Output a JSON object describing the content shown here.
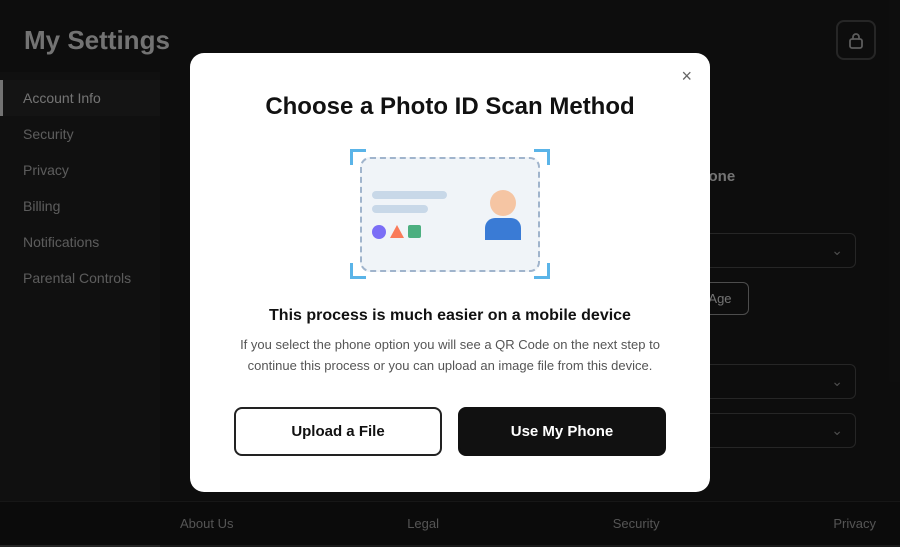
{
  "page": {
    "title": "My Settings",
    "lock_icon": "🔒"
  },
  "sidebar": {
    "items": [
      {
        "id": "account-info",
        "label": "Account Info",
        "active": true
      },
      {
        "id": "security",
        "label": "Security"
      },
      {
        "id": "privacy",
        "label": "Privacy"
      },
      {
        "id": "billing",
        "label": "Billing"
      },
      {
        "id": "notifications",
        "label": "Notifications"
      },
      {
        "id": "parental-controls",
        "label": "Parental Controls"
      }
    ]
  },
  "main": {
    "add_phone_label": "Add Phone",
    "verify_age_btn": "Verify Age"
  },
  "footer": {
    "items": [
      "About Us",
      "Legal",
      "Security",
      "Privacy"
    ]
  },
  "modal": {
    "title": "Choose a Photo ID Scan Method",
    "hint_title": "This process is much easier on a mobile device",
    "hint_desc": "If you select the phone option you will see a QR Code on the next step to continue this process or you can upload an image file from this device.",
    "btn_upload": "Upload a File",
    "btn_phone": "Use My Phone",
    "close_label": "×"
  }
}
